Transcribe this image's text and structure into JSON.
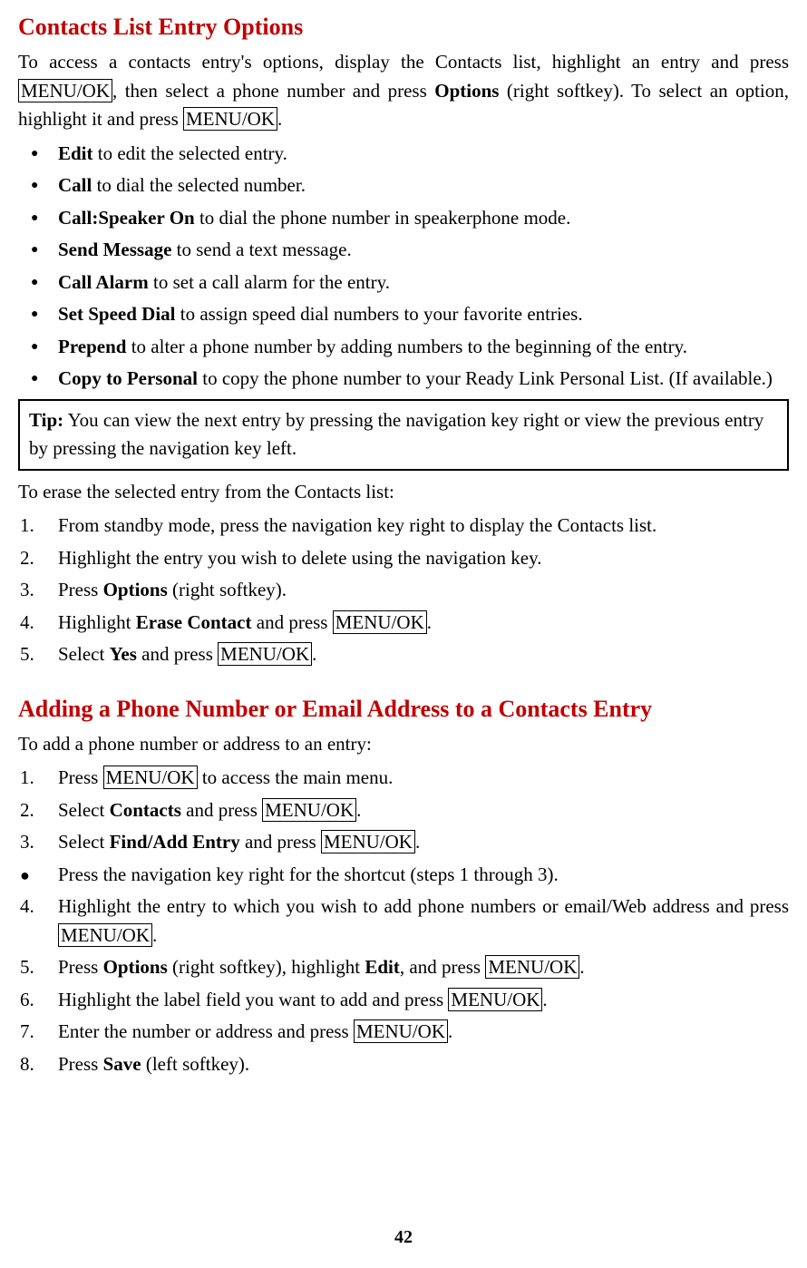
{
  "section1": {
    "title": "Contacts List Entry Options",
    "intro_a": "To access a contacts entry's options, display the Contacts list, highlight an entry and press ",
    "key_menu_ok": "MENU/OK",
    "intro_b": ", then select a phone number and press ",
    "options_b": "Options",
    "intro_c": " (right softkey). To select an option, highlight it and press ",
    "intro_d": ".",
    "bullets": [
      {
        "bold": "Edit",
        "rest": " to edit the selected entry."
      },
      {
        "bold": "Call",
        "rest": " to dial the selected number."
      },
      {
        "bold": "Call:Speaker On",
        "rest": " to dial the phone number in speakerphone mode."
      },
      {
        "bold": "Send Message",
        "rest": " to send a text message."
      },
      {
        "bold": "Call Alarm",
        "rest": " to set a call alarm for the entry."
      },
      {
        "bold": "Set Speed Dial",
        "rest": " to assign speed dial numbers to your favorite entries."
      },
      {
        "bold": "Prepend",
        "rest": " to alter a phone number by adding numbers to the beginning of the entry."
      },
      {
        "bold": "Copy to Personal",
        "rest": " to copy the phone number to your Ready Link Personal List. (If available.)"
      }
    ],
    "tip_label": "Tip:",
    "tip_text": " You can view the next entry by pressing the navigation key right or view the previous entry by pressing the navigation key left.",
    "erase_intro": "To erase the selected entry from the Contacts list:",
    "erase_steps": {
      "s1": "From standby mode, press the navigation key right to display the Contacts list.",
      "s2": "Highlight the entry you wish to delete using the navigation key.",
      "s3_a": "Press ",
      "s3_options": "Options",
      "s3_b": " (right softkey).",
      "s4_a": "Highlight ",
      "s4_erase": "Erase Contact",
      "s4_b": " and press ",
      "s4_c": ".",
      "s5_a": "Select ",
      "s5_yes": "Yes",
      "s5_b": " and press ",
      "s5_c": "."
    }
  },
  "section2": {
    "title": "Adding a Phone Number or Email Address to a Contacts Entry",
    "intro": "To add a phone number or address to an entry:",
    "s1_a": "Press ",
    "s1_b": " to access the main menu.",
    "s2_a": "Select ",
    "s2_contacts": "Contacts",
    "s2_b": " and press ",
    "s2_c": ".",
    "s3_a": "Select ",
    "s3_find": "Find/Add Entry",
    "s3_b": " and press ",
    "s3_c": ".",
    "bullet1": "Press the navigation key right for the shortcut (steps 1 through 3).",
    "s4_a": "Highlight the entry to which you wish to add phone numbers or email/Web address and press ",
    "s4_b": ".",
    "s5_a": "Press ",
    "s5_options": "Options",
    "s5_b": " (right softkey), highlight ",
    "s5_edit": "Edit",
    "s5_c": ", and press ",
    "s5_d": ".",
    "s6_a": "Highlight the label field you want to add and press ",
    "s6_b": ".",
    "s7_a": "Enter the number or address and press ",
    "s7_b": ".",
    "s8_a": "Press ",
    "s8_save": "Save",
    "s8_b": " (left softkey)."
  },
  "page_number": "42"
}
